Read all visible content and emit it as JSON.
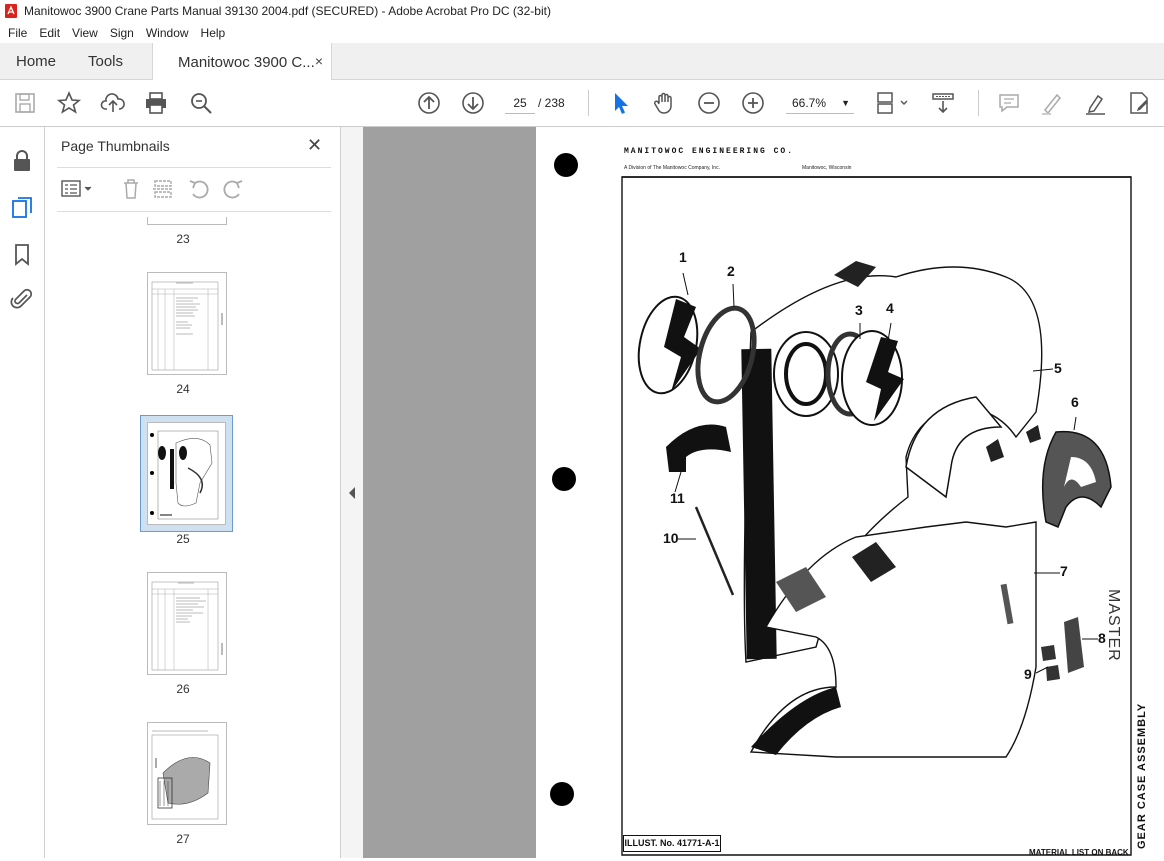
{
  "window": {
    "title": "Manitowoc 3900 Crane Parts Manual 39130 2004.pdf (SECURED) - Adobe Acrobat Pro DC (32-bit)"
  },
  "menu": [
    "File",
    "Edit",
    "View",
    "Sign",
    "Window",
    "Help"
  ],
  "tabs": {
    "home": "Home",
    "tools": "Tools",
    "doc": "Manitowoc 3900 C...",
    "close": "×"
  },
  "toolbar": {
    "page_current": "25",
    "page_total": "/ 238",
    "zoom": "66.7%"
  },
  "panel": {
    "title": "Page Thumbnails",
    "close": "✕",
    "thumbnails": [
      "23",
      "24",
      "25",
      "26",
      "27"
    ]
  },
  "page": {
    "header": "MANITOWOC ENGINEERING CO.",
    "subheader_left": "A Division of The Manitowoc Company, Inc.",
    "subheader_right": "Manitowoc, Wisconsin",
    "callouts": [
      "1",
      "2",
      "3",
      "4",
      "5",
      "6",
      "7",
      "8",
      "9",
      "10",
      "11"
    ],
    "stamp": "MASTER",
    "side_title": "GEAR CASE ASSEMBLY",
    "illust_no": "ILLUST. No. 41771-A-1",
    "footer": "MATERIAL LIST ON BACK"
  }
}
